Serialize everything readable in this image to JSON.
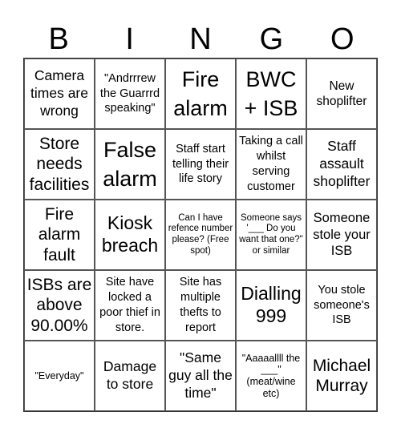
{
  "header": {
    "letters": [
      "B",
      "I",
      "N",
      "G",
      "O"
    ]
  },
  "cells": [
    [
      "Camera times are wrong",
      "\"Andrrrew the Guarrrd speaking\"",
      "Fire alarm",
      "BWC + ISB",
      "New shoplifter"
    ],
    [
      "Store needs facilities",
      "False alarm",
      "Staff start telling their life story",
      "Taking a call whilst serving customer",
      "Staff assault shoplifter"
    ],
    [
      "Fire alarm fault",
      "Kiosk breach",
      "Can I have refence number please? (Free spot)",
      "Someone says '___ Do you want that one?\" or similar",
      "Someone stole your ISB"
    ],
    [
      "ISBs are above 90.00%",
      "Site have locked a poor thief in store.",
      "Site has multiple thefts to report",
      "Dialling 999",
      "You stole someone's ISB"
    ],
    [
      "\"Everyday\"",
      "Damage to store",
      "\"Same guy all the time\"",
      "\"Aaaaallll the ___\" (meat/wine etc)",
      "Michael Murray"
    ]
  ]
}
